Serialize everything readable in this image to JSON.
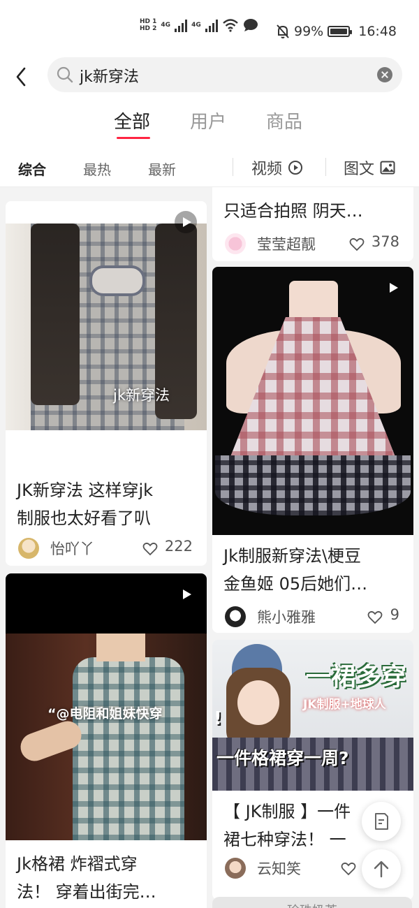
{
  "status_bar": {
    "hd1": "HD 1",
    "hd2": "HD 2",
    "net1": "4G",
    "net2": "4G",
    "battery": "99%",
    "time": "16:48"
  },
  "search": {
    "query": "jk新穿法",
    "placeholder": "jk新穿法"
  },
  "main_tabs": [
    "全部",
    "用户",
    "商品"
  ],
  "filters": {
    "items": [
      "综合",
      "最热",
      "最新"
    ],
    "video": "视频",
    "image_text": "图文"
  },
  "cards": [
    {
      "overlay": "jk新穿法",
      "title1": "JK新穿法 这样穿jk",
      "title2": "制服也太好看了叭",
      "author": "怡吖丫",
      "likes": "222"
    },
    {
      "overlay": "“@电阻和姐妹快穿",
      "title1": "Jk格裙 炸褶式穿",
      "title2": "法！ 穿着出街完…",
      "author": "",
      "likes": ""
    },
    {
      "title2": "只适合拍照 阴天…",
      "author": "莹莹超靓",
      "likes": "378"
    },
    {
      "title1": "Jk制服新穿法\\梗豆",
      "title2": "金鱼姬 05后她们…",
      "author": "熊小雅雅",
      "likes": "9"
    },
    {
      "overlay_big": "一裙多穿",
      "overlay_tag": "JK制服+地球人",
      "overlay_q": "一件格裙穿一周?",
      "overlay_left": "!",
      "title1": "【 JK制服 】一件",
      "title2": "裙七种穿法！ 一",
      "author": "云知笑",
      "likes": ""
    }
  ],
  "next_card_label": "珍珠奶茶",
  "colors": {
    "accent": "#ff2442",
    "text_primary": "#222222",
    "text_secondary": "#999999"
  },
  "icons": [
    "back-arrow-icon",
    "search-icon",
    "clear-icon",
    "play-icon",
    "image-icon",
    "heart-icon",
    "edit-icon",
    "arrow-up-icon"
  ]
}
